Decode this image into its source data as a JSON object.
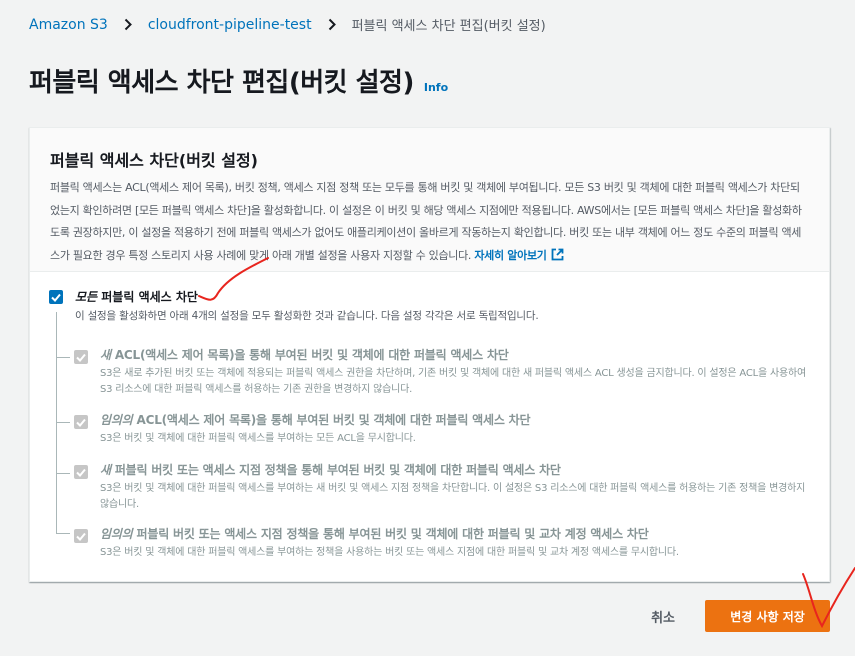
{
  "breadcrumb": {
    "root": "Amazon S3",
    "bucket": "cloudfront-pipeline-test",
    "current": "퍼블릭 액세스 차단 편집(버킷 설정)"
  },
  "page": {
    "title": "퍼블릭 액세스 차단 편집(버킷 설정)",
    "info": "Info"
  },
  "panel": {
    "title": "퍼블릭 액세스 차단(버킷 설정)",
    "description": "퍼블릭 액세스는 ACL(액세스 제어 목록), 버킷 정책, 액세스 지점 정책 또는 모두를 통해 버킷 및 객체에 부여됩니다. 모든 S3 버킷 및 객체에 대한 퍼블릭 액세스가 차단되었는지 확인하려면 [모든 퍼블릭 액세스 차단]을 활성화합니다. 이 설정은 이 버킷 및 해당 액세스 지점에만 적용됩니다. AWS에서는 [모든 퍼블릭 액세스 차단]을 활성화하도록 권장하지만, 이 설정을 적용하기 전에 퍼블릭 액세스가 없어도 애플리케이션이 올바르게 작동하는지 확인합니다. 버킷 또는 내부 객체에 어느 정도 수준의 퍼블릭 액세스가 필요한 경우 특정 스토리지 사용 사례에 맞게 아래 개별 설정을 사용자 지정할 수 있습니다.",
    "learn_more": "자세히 알아보기"
  },
  "block_all": {
    "label_em": "모든",
    "label_rest": " 퍼블릭 액세스 차단",
    "description": "이 설정을 활성화하면 아래 4개의 설정을 모두 활성화한 것과 같습니다. 다음 설정 각각은 서로 독립적입니다.",
    "checked": true
  },
  "options": [
    {
      "label_em": "새",
      "label_rest": " ACL(액세스 제어 목록)을 통해 부여된 버킷 및 객체에 대한 퍼블릭 액세스 차단",
      "description": "S3은 새로 추가된 버킷 또는 객체에 적용되는 퍼블릭 액세스 권한을 차단하며, 기존 버킷 및 객체에 대한 새 퍼블릭 액세스 ACL 생성을 금지합니다. 이 설정은 ACL을 사용하여 S3 리소스에 대한 퍼블릭 액세스를 허용하는 기존 권한을 변경하지 않습니다."
    },
    {
      "label_em": "임의의",
      "label_rest": " ACL(액세스 제어 목록)을 통해 부여된 버킷 및 객체에 대한 퍼블릭 액세스 차단",
      "description": "S3은 버킷 및 객체에 대한 퍼블릭 액세스를 부여하는 모든 ACL을 무시합니다."
    },
    {
      "label_em": "새",
      "label_rest": " 퍼블릭 버킷 또는 액세스 지점 정책을 통해 부여된 버킷 및 객체에 대한 퍼블릭 액세스 차단",
      "description": "S3은 버킷 및 객체에 대한 퍼블릭 액세스를 부여하는 새 버킷 및 액세스 지점 정책을 차단합니다. 이 설정은 S3 리소스에 대한 퍼블릭 액세스를 허용하는 기존 정책을 변경하지 않습니다."
    },
    {
      "label_em": "임의의",
      "label_rest": " 퍼블릭 버킷 또는 액세스 지점 정책을 통해 부여된 버킷 및 객체에 대한 퍼블릭 및 교차 계정 액세스 차단",
      "description": "S3은 버킷 및 객체에 대한 퍼블릭 액세스를 부여하는 정책을 사용하는 버킷 또는 액세스 지점에 대한 퍼블릭 및 교차 계정 액세스를 무시합니다."
    }
  ],
  "actions": {
    "cancel": "취소",
    "save": "변경 사항 저장"
  },
  "colors": {
    "link": "#0073bb",
    "primary_button": "#ec7211",
    "annotation": "#e8251e",
    "checkbox_checked": "#0073bb",
    "checkbox_disabled": "#c6c6c6"
  },
  "icons": [
    "chevron-right-icon",
    "external-link-icon",
    "checkmark-icon"
  ]
}
